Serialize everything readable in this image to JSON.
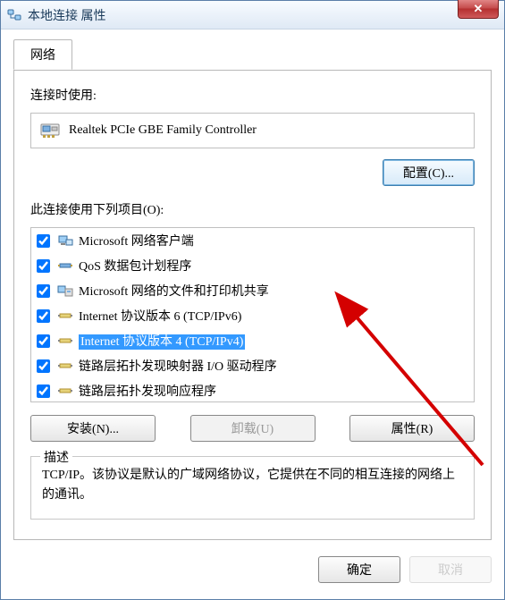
{
  "window": {
    "title": "本地连接 属性",
    "close_glyph": "✕"
  },
  "tab": {
    "label": "网络"
  },
  "adapter": {
    "label": "连接时使用:",
    "name": "Realtek PCIe GBE Family Controller",
    "configure_btn": "配置(C)..."
  },
  "items": {
    "label": "此连接使用下列项目(O):",
    "list": [
      {
        "checked": true,
        "icon": "client",
        "label": "Microsoft 网络客户端"
      },
      {
        "checked": true,
        "icon": "qos",
        "label": "QoS 数据包计划程序"
      },
      {
        "checked": true,
        "icon": "sharing",
        "label": "Microsoft 网络的文件和打印机共享"
      },
      {
        "checked": true,
        "icon": "proto",
        "label": "Internet 协议版本 6 (TCP/IPv6)"
      },
      {
        "checked": true,
        "icon": "proto",
        "label": "Internet 协议版本 4 (TCP/IPv4)",
        "selected": true
      },
      {
        "checked": true,
        "icon": "proto",
        "label": "链路层拓扑发现映射器 I/O 驱动程序"
      },
      {
        "checked": true,
        "icon": "proto",
        "label": "链路层拓扑发现响应程序"
      }
    ]
  },
  "buttons": {
    "install": "安装(N)...",
    "uninstall": "卸载(U)",
    "properties": "属性(R)"
  },
  "description": {
    "legend": "描述",
    "text": "TCP/IP。该协议是默认的广域网络协议，它提供在不同的相互连接的网络上的通讯。"
  },
  "footer": {
    "ok": "确定",
    "cancel_hint": "取消"
  }
}
